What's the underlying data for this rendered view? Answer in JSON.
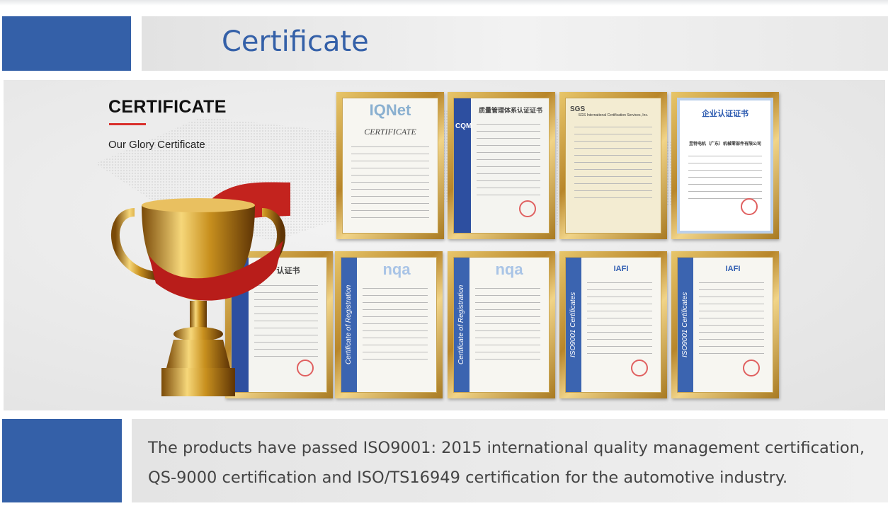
{
  "header": {
    "title": "Certificate"
  },
  "intro": {
    "heading": "CERTIFICATE",
    "subheading": "Our Glory Certificate"
  },
  "certificates": [
    {
      "heading": "CERTIFICATE",
      "logo": "IQNet"
    },
    {
      "heading": "质量管理体系认证证书",
      "logo": "CQM"
    },
    {
      "heading": "SGS International Certification Services, Inc.",
      "logo": "SGS"
    },
    {
      "heading": "企业认证证书",
      "logo": "昱特电机（广东）机械零部件有限公司"
    },
    {
      "heading": "认证书",
      "logo": "",
      "side": ""
    },
    {
      "heading": "",
      "logo": "nqa",
      "side": "Certificate of Registration"
    },
    {
      "heading": "",
      "logo": "nqa",
      "side": "Certificate of Registration"
    },
    {
      "heading": "IAFI",
      "logo": "",
      "side": "ISO9001 Certificates"
    },
    {
      "heading": "IAFI",
      "logo": "",
      "side": "ISO9001 Certificates"
    }
  ],
  "footer": {
    "lines": [
      "The products have passed ISO9001: 2015 international quality management certification,",
      "QS-9000 certification and ISO/TS16949 certification for the automotive industry."
    ]
  }
}
